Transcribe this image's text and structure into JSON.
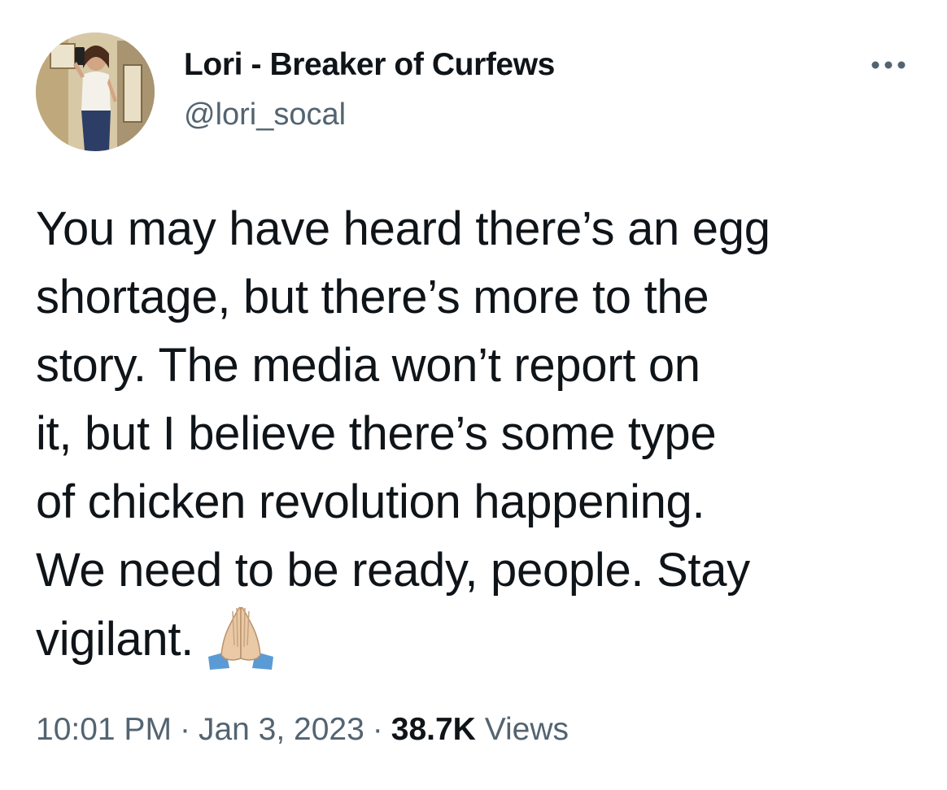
{
  "author": {
    "display_name": "Lori - Breaker of Curfews",
    "handle": "@lori_socal"
  },
  "tweet": {
    "lines": [
      "You may have heard there’s an egg",
      "shortage, but there’s more to the",
      "story. The media won’t report on",
      "it, but I believe there’s some type",
      "of chicken revolution happening.",
      "We need to be ready, people. Stay",
      "vigilant."
    ],
    "emoji": "folded-hands-light-skin-tone"
  },
  "meta": {
    "time": "10:01 PM",
    "separator": "·",
    "date": "Jan 3, 2023",
    "views_count": "38.7K",
    "views_label": "Views"
  },
  "icons": {
    "more": "more-horizontal-icon"
  },
  "colors": {
    "text_primary": "#0f1419",
    "text_secondary": "#536471",
    "background": "#ffffff"
  }
}
